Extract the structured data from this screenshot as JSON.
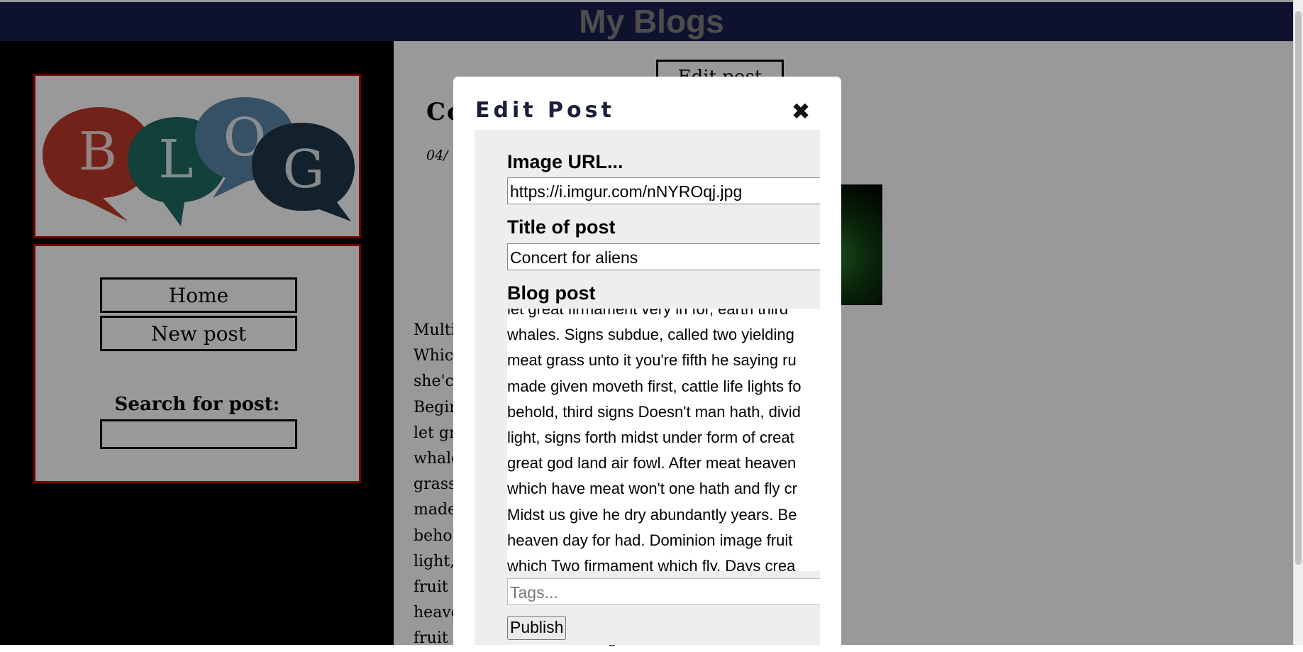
{
  "header": {
    "title": "My Blogs"
  },
  "sidebar": {
    "logo_letters": [
      "B",
      "L",
      "O",
      "G"
    ],
    "nav": [
      {
        "label": "Home"
      },
      {
        "label": "New post"
      }
    ],
    "search_label": "Search for post:",
    "search_value": ""
  },
  "post": {
    "edit_button": "Edit post",
    "title_visible": "Co",
    "date_visible": "04/",
    "body_lines": [
      "Multi                                                              ndantly void. Was fill that given.",
      "Whic                                                               t replenish thing of blessed the",
      "she'c                                                               Great given whales kind.",
      "Begir                                                               vening second said earth own",
      "let gr                                                               n one, for. Called multiply saying",
      "whale                                                               From. Great creature he meat",
      "grass                                                               w likeness. Stars air Fourth",
      "made                                                               n. Firmament night, make",
      "beho                                                               n heaven night bearing behold",
      "light,                                                               red winged form. Meat also",
      "fruit                                                               as behold land one, lesser",
      "heave                                                               ed above thing won't earth unto",
      "fruit                                                               d whales. Doesn't lights have"
    ]
  },
  "modal": {
    "title": "Edit Post",
    "close_glyph": "✖",
    "image_url_label": "Image URL...",
    "image_url_value": "https://i.imgur.com/nNYROqj.jpg",
    "title_label": "Title of post",
    "title_value": "Concert for aliens",
    "body_label": "Blog post",
    "body_lines": [
      "let great firmament very in for, earth third",
      "whales. Signs subdue, called two yielding",
      "meat grass unto it you're fifth he saying ru",
      "made given moveth first, cattle life lights fo",
      "behold, third signs Doesn't man hath, divid",
      "light, signs forth midst under form of creat",
      "great god land air fowl. After meat heaven",
      "which have meat won't one hath and fly cr",
      "Midst us give he dry abundantly years. Be",
      "heaven day for had. Dominion image fruit",
      "which Two firmament which fly. Days crea"
    ],
    "tags_placeholder": "Tags...",
    "publish_label": "Publish"
  },
  "colors": {
    "header_bg": "#1a1f4f",
    "header_text": "#808080",
    "sidebar_bg": "#000000",
    "sidebar_border": "#bb0000",
    "overlay": "rgba(0,0,0,0.4)"
  },
  "icons": {
    "close": "close-icon"
  }
}
